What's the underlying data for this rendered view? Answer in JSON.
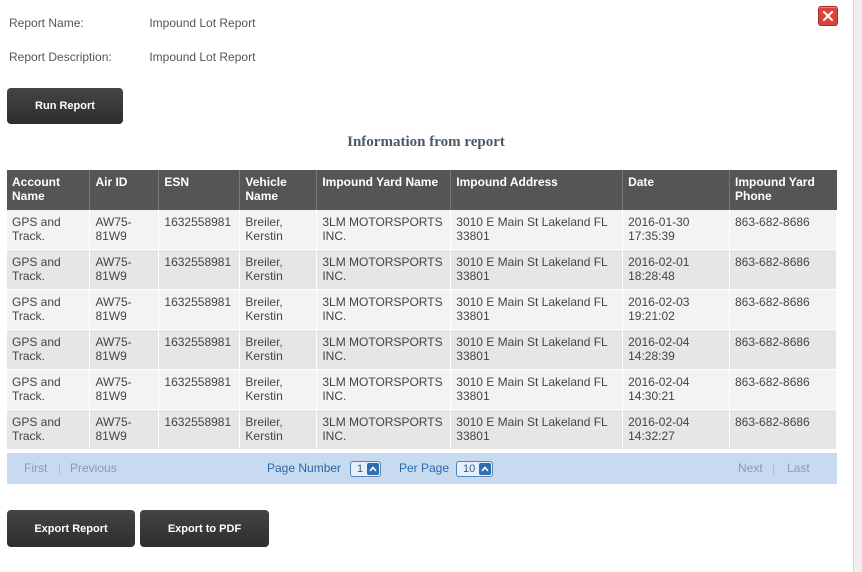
{
  "dialog": {
    "close_icon": "close-x-icon",
    "close_color": "#d9453d"
  },
  "meta": {
    "report_name_label": "Report Name:",
    "report_name_value": "Impound Lot Report",
    "report_description_label": "Report Description:",
    "report_description_value": "Impound Lot Report"
  },
  "run_report_label": "Run Report",
  "section_title": "Information from report",
  "table": {
    "headers": [
      "Account Name",
      "Air ID",
      "ESN",
      "Vehicle Name",
      "Impound Yard Name",
      "Impound Address",
      "Date",
      "Impound Yard Phone"
    ],
    "rows": [
      [
        "GPS and Track.",
        "AW75-81W9",
        "1632558981",
        "Breiler, Kerstin",
        "3LM MOTORSPORTS INC.",
        "3010 E Main St Lakeland FL 33801",
        "2016-01-30 17:35:39",
        "863-682-8686"
      ],
      [
        "GPS and Track.",
        "AW75-81W9",
        "1632558981",
        "Breiler, Kerstin",
        "3LM MOTORSPORTS INC.",
        "3010 E Main St Lakeland FL 33801",
        "2016-02-01 18:28:48",
        "863-682-8686"
      ],
      [
        "GPS and Track.",
        "AW75-81W9",
        "1632558981",
        "Breiler, Kerstin",
        "3LM MOTORSPORTS INC.",
        "3010 E Main St Lakeland FL 33801",
        "2016-02-03 19:21:02",
        "863-682-8686"
      ],
      [
        "GPS and Track.",
        "AW75-81W9",
        "1632558981",
        "Breiler, Kerstin",
        "3LM MOTORSPORTS INC.",
        "3010 E Main St Lakeland FL 33801",
        "2016-02-04 14:28:39",
        "863-682-8686"
      ],
      [
        "GPS and Track.",
        "AW75-81W9",
        "1632558981",
        "Breiler, Kerstin",
        "3LM MOTORSPORTS INC.",
        "3010 E Main St Lakeland FL 33801",
        "2016-02-04 14:30:21",
        "863-682-8686"
      ],
      [
        "GPS and Track.",
        "AW75-81W9",
        "1632558981",
        "Breiler, Kerstin",
        "3LM MOTORSPORTS INC.",
        "3010 E Main St Lakeland FL 33801",
        "2016-02-04 14:32:27",
        "863-682-8686"
      ]
    ]
  },
  "pager": {
    "first": "First",
    "previous": "Previous",
    "page_number_label": "Page Number",
    "page_number_value": "1",
    "per_page_label": "Per Page",
    "per_page_value": "10",
    "next": "Next",
    "last": "Last",
    "separator": "|"
  },
  "actions": {
    "export_report_label": "Export Report",
    "export_pdf_label": "Export to PDF"
  }
}
